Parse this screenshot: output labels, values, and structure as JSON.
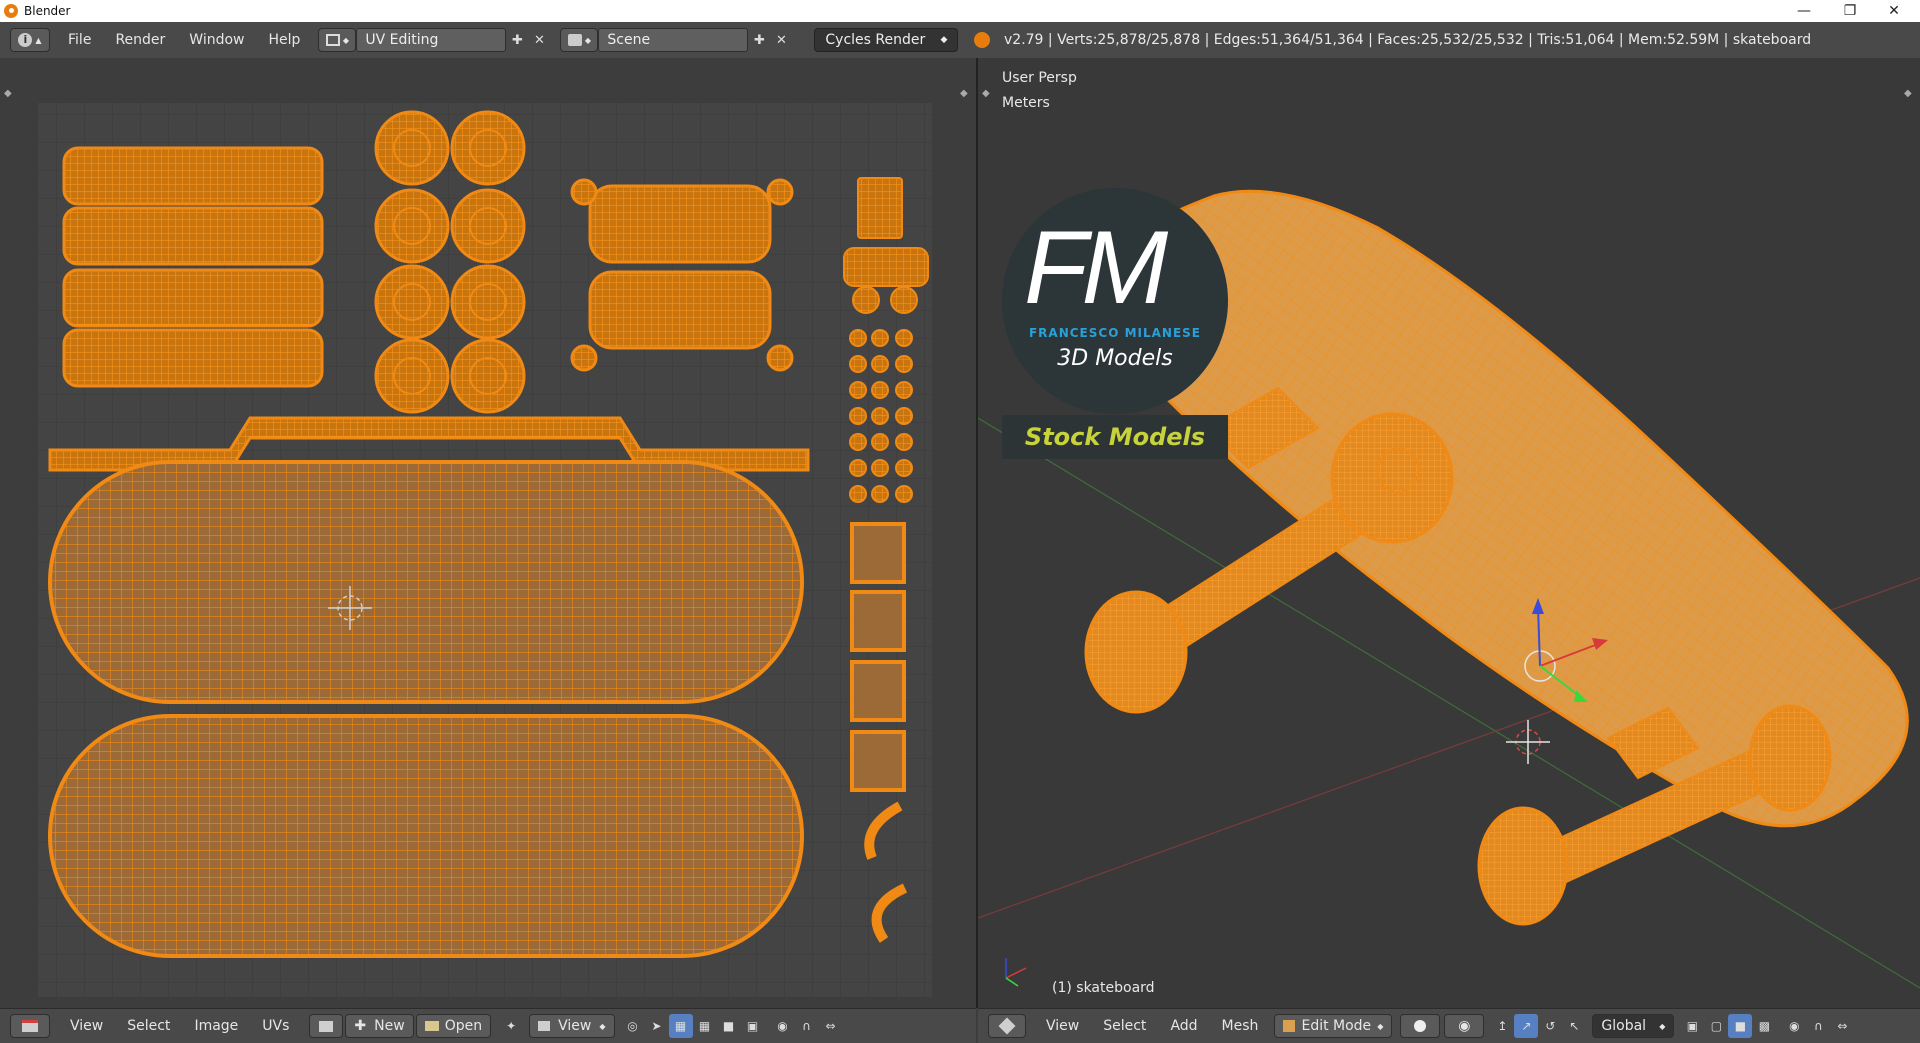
{
  "window": {
    "title": "Blender",
    "controls": [
      "minimize",
      "restore",
      "close"
    ]
  },
  "infobar": {
    "menus": [
      "File",
      "Render",
      "Window",
      "Help"
    ],
    "screen_layout": "UV Editing",
    "scene": "Scene",
    "render_engine": "Cycles Render",
    "stats": "v2.79 | Verts:25,878/25,878 | Edges:51,364/51,364 | Faces:25,532/25,532 | Tris:51,064 | Mem:52.59M | skateboard"
  },
  "uv_editor": {
    "footer_menus": [
      "View",
      "Select",
      "Image",
      "UVs"
    ],
    "new_label": "New",
    "open_label": "Open",
    "view_label": "View"
  },
  "viewport": {
    "view_name": "User Persp",
    "units": "Meters",
    "object_label": "(1) skateboard",
    "footer_menus": [
      "View",
      "Select",
      "Add",
      "Mesh"
    ],
    "mode": "Edit Mode",
    "orientation": "Global"
  },
  "watermark": {
    "monogram": "FM",
    "author": "FRANCESCO MILANESE",
    "tagline": "3D Models",
    "banner": "Stock Models"
  },
  "colors": {
    "uv_orange": "#f08a14",
    "mesh_fill": "#e7a043",
    "header": "#494949",
    "logo_blue": "#2aa0d8",
    "logo_yellow": "#c8d23a"
  }
}
